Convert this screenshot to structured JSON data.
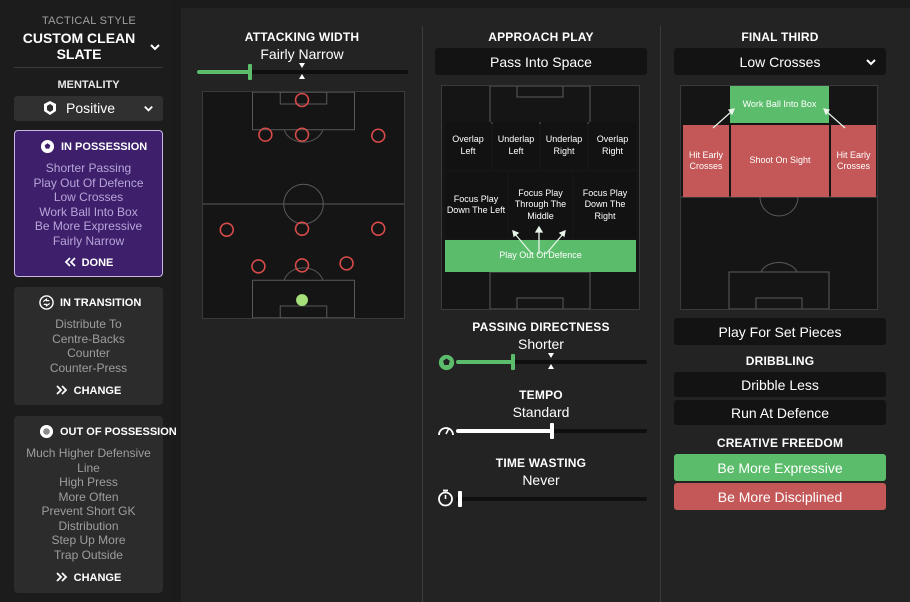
{
  "sidebar": {
    "tactical_style_label": "TACTICAL STYLE",
    "tactical_style_name": "CUSTOM CLEAN SLATE",
    "mentality_label": "MENTALITY",
    "mentality_value": "Positive",
    "in_possession": {
      "title": "IN POSSESSION",
      "items": [
        "Shorter Passing",
        "Play Out Of Defence",
        "Low Crosses",
        "Work Ball Into Box",
        "Be More Expressive",
        "Fairly Narrow"
      ],
      "button": "DONE"
    },
    "in_transition": {
      "title": "IN TRANSITION",
      "items": [
        "Distribute To",
        "Centre-Backs",
        "Counter",
        "Counter-Press"
      ],
      "button": "CHANGE"
    },
    "out_of_possession": {
      "title": "OUT OF POSSESSION",
      "items": [
        "Much Higher Defensive",
        "Line",
        "High Press",
        "More Often",
        "Prevent Short GK",
        "Distribution",
        "Step Up More",
        "Trap Outside"
      ],
      "button": "CHANGE"
    }
  },
  "attacking_width": {
    "title": "ATTACKING WIDTH",
    "value": "Fairly Narrow",
    "level": 0.25
  },
  "approach_play": {
    "title": "APPROACH PLAY",
    "selected": "Pass Into Space",
    "zones": {
      "overlap_left": "Overlap Left",
      "underlap_left": "Underlap Left",
      "underlap_right": "Underlap Right",
      "overlap_right": "Overlap Right",
      "focus_left": "Focus Play Down The Left",
      "focus_middle": "Focus Play Through The Middle",
      "focus_right": "Focus Play Down The Right",
      "play_out": "Play Out Of Defence"
    }
  },
  "passing_directness": {
    "title": "PASSING DIRECTNESS",
    "value": "Shorter",
    "level": 0.3
  },
  "tempo": {
    "title": "TEMPO",
    "value": "Standard",
    "level": 0.5
  },
  "time_wasting": {
    "title": "TIME WASTING",
    "value": "Never",
    "level": 0
  },
  "final_third": {
    "title": "FINAL THIRD",
    "selected": "Low Crosses",
    "zones": {
      "work_ball": "Work Ball Into Box",
      "hit_early_left": "Hit Early Crosses",
      "shoot_on_sight": "Shoot On Sight",
      "hit_early_right": "Hit Early Crosses"
    },
    "set_pieces": "Play For Set Pieces"
  },
  "dribbling": {
    "title": "DRIBBLING",
    "options": [
      "Dribble Less",
      "Run At Defence"
    ]
  },
  "creative_freedom": {
    "title": "CREATIVE FREEDOM",
    "options": [
      "Be More Expressive",
      "Be More Disciplined"
    ]
  },
  "colors": {
    "accent_green": "#5bbd6b",
    "accent_red": "#c45858",
    "possession_purple": "#3d1f6b",
    "player_ring": "#d94b4b",
    "goalkeeper": "#a6e07a"
  },
  "icons": {
    "mentality": "positive-shield-icon",
    "in_possession": "ball-icon",
    "in_transition": "transition-icon",
    "out_of_possession": "out-possession-icon",
    "passing": "ball-icon",
    "tempo": "speedometer-icon",
    "time_wasting": "stopwatch-icon"
  }
}
